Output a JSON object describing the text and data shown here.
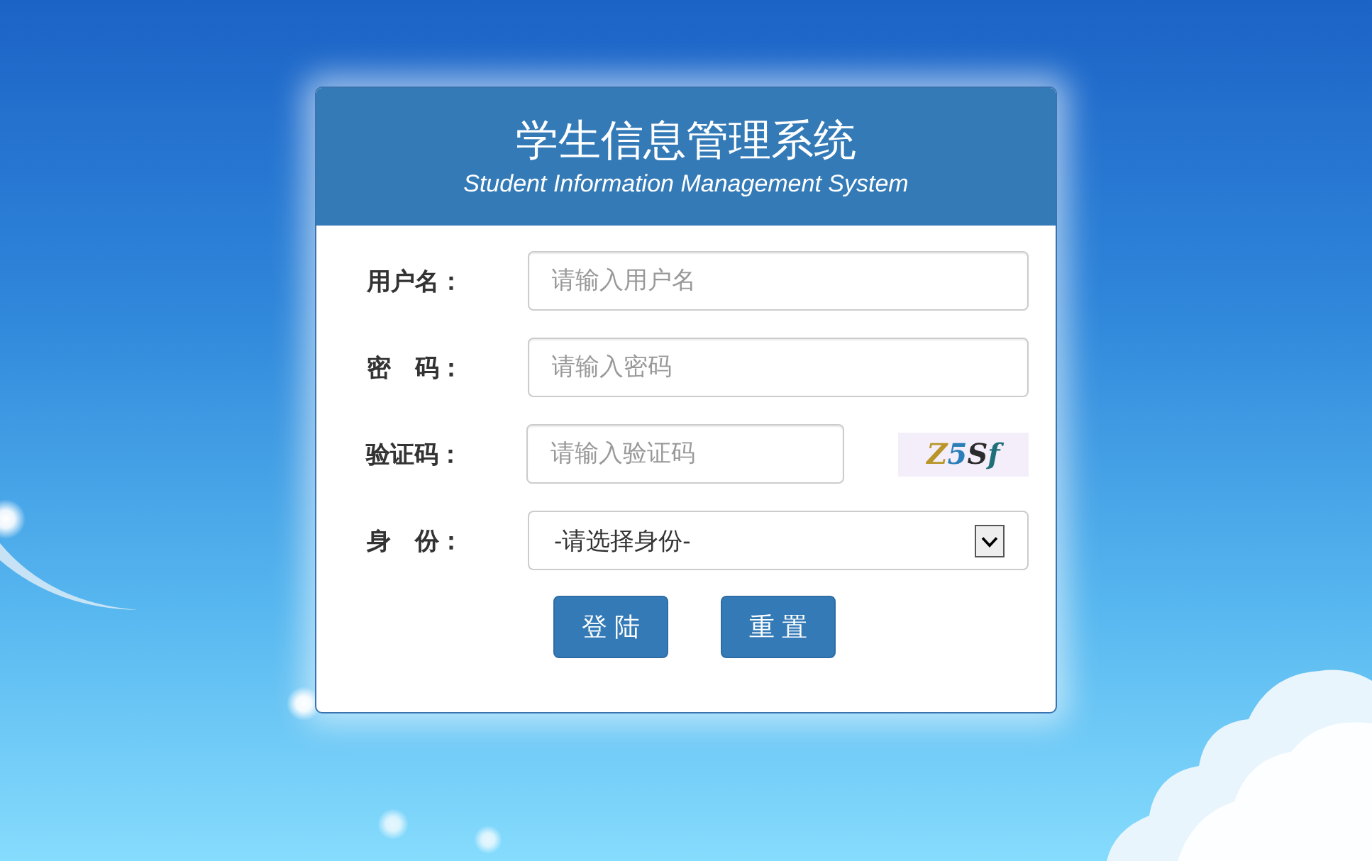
{
  "header": {
    "title": "学生信息管理系统",
    "subtitle": "Student Information Management System"
  },
  "fields": [
    {
      "kind": "text",
      "label": "用户名：",
      "placeholder": "请输入用户名"
    },
    {
      "kind": "password",
      "label": "密　码：",
      "placeholder": "请输入密码"
    },
    {
      "kind": "captcha",
      "label": "验证码：",
      "placeholder": "请输入验证码",
      "captcha": "Z5Sf"
    },
    {
      "kind": "select",
      "label": "身　份：",
      "value": "-请选择身份-"
    }
  ],
  "buttons": [
    "登 陆",
    "重 置"
  ]
}
